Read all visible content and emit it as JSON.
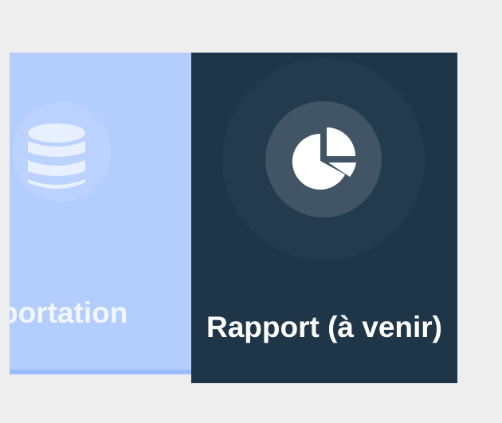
{
  "tiles": {
    "import": {
      "label": "portation",
      "icon": "database-icon",
      "bg_color": "#b3cdfd"
    },
    "report": {
      "label": "Rapport (à venir)",
      "icon": "pie-chart-icon",
      "bg_color": "#1f3649"
    }
  }
}
